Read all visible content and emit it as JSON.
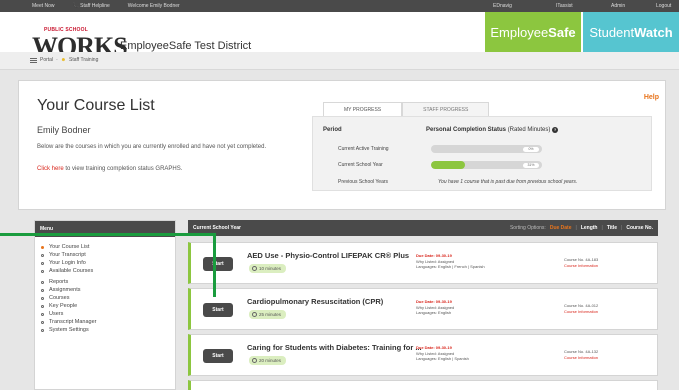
{
  "topbar": {
    "meet_now": "Meet Now",
    "staff_helpline": "Staff Helpline",
    "welcome": "Welcome Emily Bodner",
    "right": [
      "EDnavig",
      "ITassist",
      "Admin",
      "Logout"
    ]
  },
  "header": {
    "logo_super": "PUBLIC SCHOOL",
    "logo_word": "WORKS",
    "district": "EmployeeSafe Test District",
    "tab_employee_a": "Employee",
    "tab_employee_b": "Safe",
    "tab_student_a": "Student",
    "tab_student_b": "Watch"
  },
  "breadcrumb": {
    "portal": "Portal",
    "sep": "·",
    "staff_training": "Staff Training"
  },
  "panel": {
    "title": "Your Course List",
    "name": "Emily Bodner",
    "description": "Below are the courses in which you are currently enrolled and have not yet completed.",
    "link_red": "Click here",
    "link_rest": " to view training completion status GRAPHS.",
    "help": "Help"
  },
  "progress": {
    "tabs": [
      "MY PROGRESS",
      "STAFF PROGRESS"
    ],
    "period_header": "Period",
    "status_header": "Personal Completion Status",
    "status_sub": "(Rated Minutes)",
    "rows": [
      {
        "label": "Current Active Training",
        "value": "0%",
        "fraction": 0.0
      },
      {
        "label": "Current School Year",
        "value": "31%",
        "fraction": 0.31
      },
      {
        "label": "Previous School Years"
      }
    ],
    "past_due": "You have 1 course that is past due from previous school years."
  },
  "menu": {
    "header": "Menu",
    "items": [
      "Your Course List",
      "Your Transcript",
      "Your Login Info",
      "Available Courses",
      "Reports",
      "Assignments",
      "Courses",
      "Key People",
      "Users",
      "Transcript Manager",
      "System Settings"
    ]
  },
  "courses_header": {
    "title": "Current School Year",
    "sort_label": "Sorting Options:",
    "sort_options": [
      "Due Date",
      "Length",
      "Title",
      "Course No."
    ],
    "sep": "|"
  },
  "courses": [
    {
      "start": "Start",
      "title": "AED Use - Physio-Control LIFEPAK CR® Plus",
      "duration": "10 minutes",
      "due": "Due Date: 09-30-19",
      "why": "Why Listed: Assigned",
      "languages": "Languages: English | French | Spanish",
      "course_no": "Course No. 4A-183",
      "info": "Course Information"
    },
    {
      "start": "Start",
      "title": "Cardiopulmonary Resuscitation (CPR)",
      "duration": "25 minutes",
      "due": "Due Date: 09-30-19",
      "why": "Why Listed: Assigned",
      "languages": "Languages: English",
      "course_no": "Course No. 4A-012",
      "info": "Course Information"
    },
    {
      "start": "Start",
      "title": "Caring for Students with Diabetes: Training for ...",
      "duration": "20 minutes",
      "due": "Due Date: 09-30-19",
      "why": "Why Listed: Assigned",
      "languages": "Languages: English | Spanish",
      "course_no": "Course No. 4A-132",
      "info": "Course Information"
    }
  ],
  "colors": {
    "green": "#8cc63f",
    "teal": "#56c5d0",
    "orange": "#e8741c",
    "red": "#d9261c",
    "dark": "#4a4a4a",
    "annotation": "#1a9c3e"
  }
}
